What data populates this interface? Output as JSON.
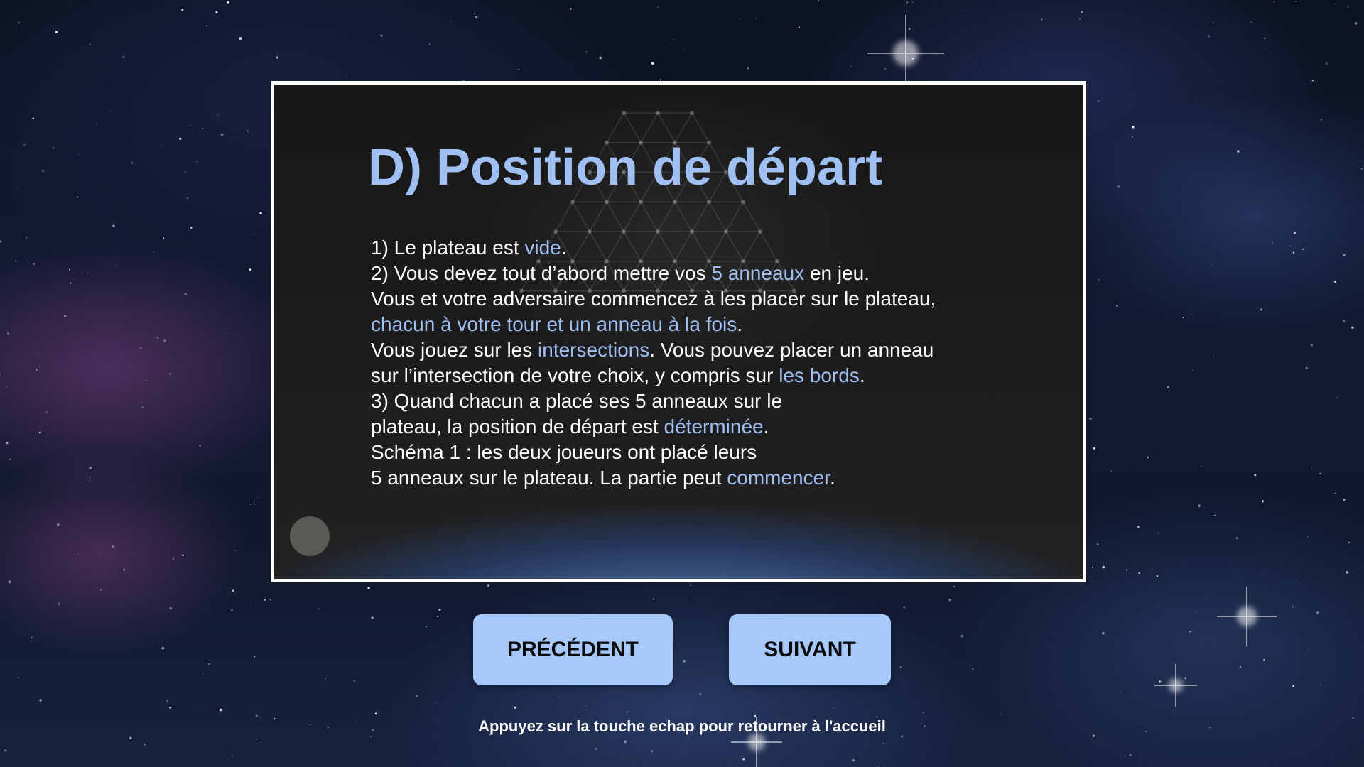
{
  "slide": {
    "title": "D) Position de départ",
    "lines": [
      [
        {
          "t": "1) Le plateau est "
        },
        {
          "t": "vide",
          "hl": true
        },
        {
          "t": "."
        }
      ],
      [
        {
          "t": "2) Vous devez tout d’abord mettre vos "
        },
        {
          "t": "5 anneaux",
          "hl": true
        },
        {
          "t": " en jeu."
        }
      ],
      [
        {
          "t": "Vous et votre adversaire commencez à les placer sur le plateau,"
        }
      ],
      [
        {
          "t": "chacun à votre tour et un anneau à la fois",
          "hl": true
        },
        {
          "t": "."
        }
      ],
      [
        {
          "t": "Vous jouez sur les "
        },
        {
          "t": "intersections",
          "hl": true
        },
        {
          "t": ". Vous pouvez placer un anneau"
        }
      ],
      [
        {
          "t": "sur l’intersection de votre choix, y compris sur "
        },
        {
          "t": "les bords",
          "hl": true
        },
        {
          "t": "."
        }
      ],
      [
        {
          "t": "3) Quand chacun a placé ses 5 anneaux sur le"
        }
      ],
      [
        {
          "t": "plateau, la position de départ est "
        },
        {
          "t": "déterminée",
          "hl": true
        },
        {
          "t": "."
        }
      ],
      [
        {
          "t": "Schéma 1 : les deux joueurs ont placé leurs"
        }
      ],
      [
        {
          "t": "5 anneaux sur le plateau. La partie peut "
        },
        {
          "t": "commencer",
          "hl": true
        },
        {
          "t": "."
        }
      ]
    ]
  },
  "nav": {
    "prev_label": "PRÉCÉDENT",
    "next_label": "SUIVANT"
  },
  "hint": "Appuyez sur la touche echap pour retourner à l'accueil",
  "colors": {
    "accent": "#a0c0f4",
    "button_bg": "#a6c8fa",
    "text": "#ffffff",
    "panel_border": "#ffffff"
  }
}
